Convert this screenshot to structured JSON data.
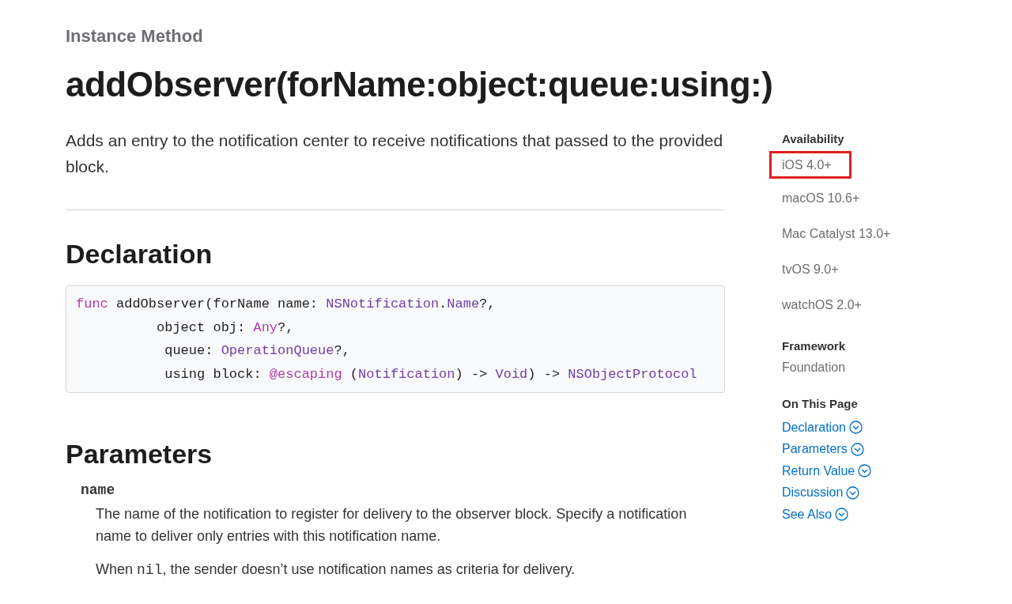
{
  "eyebrow": "Instance Method",
  "title": "addObserver(forName:object:queue:using:)",
  "abstract": "Adds an entry to the notification center to receive notifications that passed to the provided block.",
  "declaration": {
    "heading": "Declaration",
    "lines": [
      [
        {
          "kind": "keyword",
          "text": "func"
        },
        {
          "kind": "plain",
          "text": " addObserver(forName name: "
        },
        {
          "kind": "type",
          "text": "NSNotification"
        },
        {
          "kind": "plain",
          "text": "."
        },
        {
          "kind": "type",
          "text": "Name"
        },
        {
          "kind": "plain",
          "text": "?,"
        }
      ],
      [
        {
          "kind": "plain",
          "text": "          object obj: "
        },
        {
          "kind": "keyword",
          "text": "Any"
        },
        {
          "kind": "plain",
          "text": "?,"
        }
      ],
      [
        {
          "kind": "plain",
          "text": "           queue: "
        },
        {
          "kind": "type",
          "text": "OperationQueue"
        },
        {
          "kind": "plain",
          "text": "?,"
        }
      ],
      [
        {
          "kind": "plain",
          "text": "           using block: "
        },
        {
          "kind": "keyword",
          "text": "@escaping"
        },
        {
          "kind": "plain",
          "text": " ("
        },
        {
          "kind": "type",
          "text": "Notification"
        },
        {
          "kind": "plain",
          "text": ") -> "
        },
        {
          "kind": "type",
          "text": "Void"
        },
        {
          "kind": "plain",
          "text": ") -> "
        },
        {
          "kind": "type",
          "text": "NSObjectProtocol"
        }
      ]
    ]
  },
  "parameters": {
    "heading": "Parameters",
    "items": [
      {
        "name": "name",
        "paragraphs": [
          [
            {
              "kind": "text",
              "text": "The name of the notification to register for delivery to the observer block. Specify a notification name to deliver only entries with this notification name."
            }
          ],
          [
            {
              "kind": "text",
              "text": "When "
            },
            {
              "kind": "code",
              "text": "nil"
            },
            {
              "kind": "text",
              "text": ", the sender doesn’t use notification names as criteria for delivery."
            }
          ]
        ]
      }
    ]
  },
  "sidebar": {
    "availability": {
      "heading": "Availability",
      "items": [
        {
          "text": "iOS 4.0+",
          "highlighted": true
        },
        {
          "text": "macOS 10.6+",
          "highlighted": false
        },
        {
          "text": "Mac Catalyst 13.0+",
          "highlighted": false
        },
        {
          "text": "tvOS 9.0+",
          "highlighted": false
        },
        {
          "text": "watchOS 2.0+",
          "highlighted": false
        }
      ]
    },
    "framework": {
      "heading": "Framework",
      "value": "Foundation"
    },
    "on_this_page": {
      "heading": "On This Page",
      "links": [
        "Declaration",
        "Parameters",
        "Return Value",
        "Discussion",
        "See Also"
      ]
    }
  }
}
